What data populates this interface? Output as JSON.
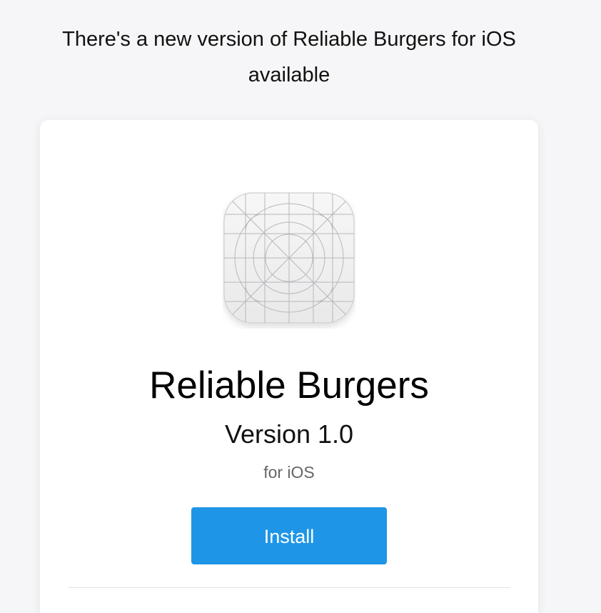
{
  "header": {
    "message": "There's a new version of Reliable Burgers for iOS available"
  },
  "app": {
    "icon": "app-icon-grid-template",
    "name": "Reliable Burgers",
    "version": "Version 1.0",
    "platform": "for iOS"
  },
  "actions": {
    "install_label": "Install"
  },
  "colors": {
    "background": "#f6f5f7",
    "card": "#ffffff",
    "install_button": "#1e95e7",
    "platform_text": "#666666"
  }
}
